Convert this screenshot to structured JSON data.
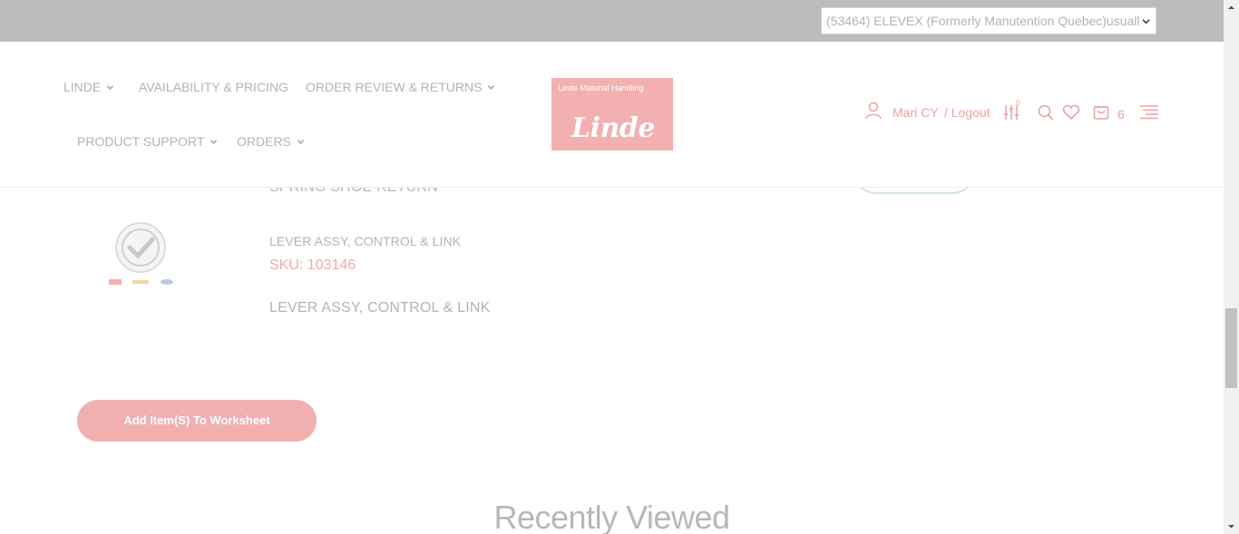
{
  "account_select": {
    "value": "(53464) ELEVEX (Formerly Manutention Quebec)usuall"
  },
  "nav": {
    "linde": "LINDE",
    "availability": "AVAILABILITY & PRICING",
    "order_review": "ORDER REVIEW & RETURNS",
    "product_support": "PRODUCT SUPPORT",
    "orders": "ORDERS"
  },
  "logo": {
    "tagline": "Linde Material Handling",
    "wordmark": "Linde"
  },
  "user": {
    "name": "Mari CY",
    "logout": "/ Logout"
  },
  "compare": {
    "count": "0"
  },
  "cart": {
    "count": "6"
  },
  "results": {
    "previous_item_title": "SPRING SHOE RETURN",
    "item": {
      "name": "LEVER ASSY, CONTROL & LINK",
      "sku": "SKU: 103146",
      "description": "LEVER ASSY, CONTROL & LINK"
    }
  },
  "actions": {
    "add_to_worksheet": "Add Item(S) To Worksheet"
  },
  "recently_viewed": {
    "title": "Recently Viewed"
  },
  "colors": {
    "brand_pink": "#f2b0b0",
    "accent_pink": "#e9a2a2",
    "muted_text": "#b3b3b3"
  }
}
